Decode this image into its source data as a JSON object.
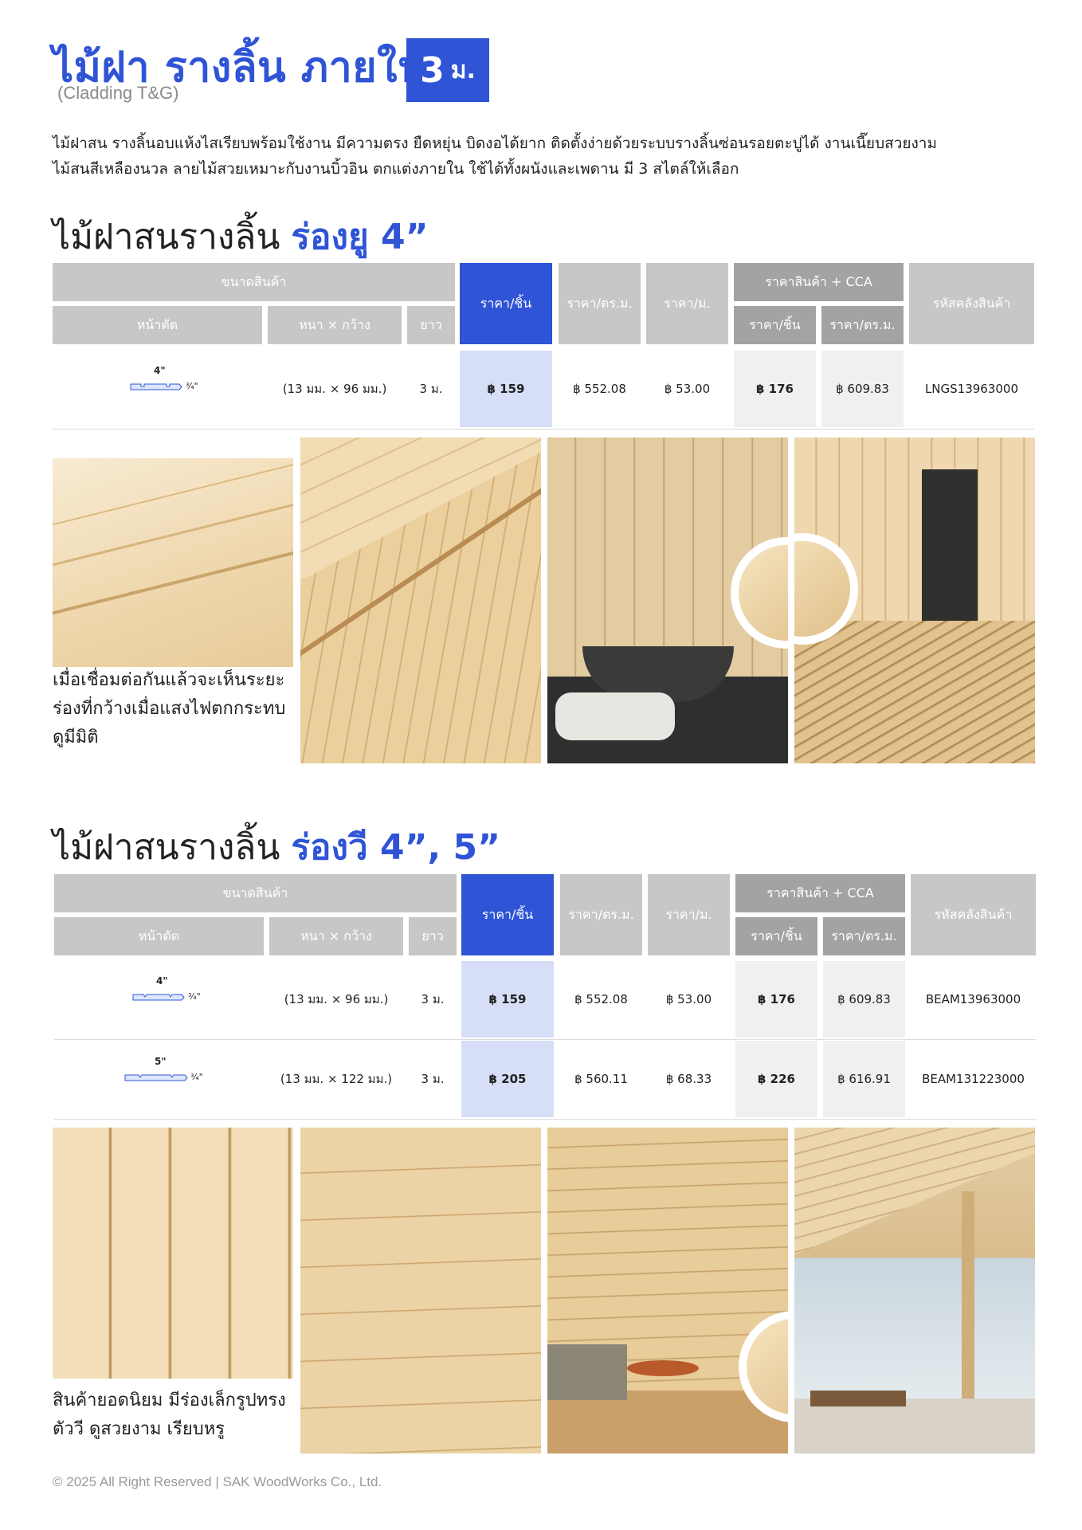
{
  "header": {
    "title": "ไม้ฝา รางลิ้น ภายใน",
    "subtitle": "(Cladding T&G)",
    "badge_number": "3",
    "badge_unit": "ม."
  },
  "intro": {
    "line1": "ไม้ฝาสน รางลิ้นอบแห้งไสเรียบพร้อมใช้งาน มีความตรง ยืดหยุ่น บิดงอได้ยาก ติดตั้งง่ายด้วยระบบรางลิ้นซ่อนรอยตะปูได้ งานเนี๊ยบสวยงาม",
    "line2": "ไม้สนสีเหลืองนวล ลายไม้สวยเหมาะกับงานบิ้วอิน ตกแต่งภายใน ใช้ได้ทั้งผนังและเพดาน มี 3 สไตล์ให้เลือก"
  },
  "table_headers": {
    "size": "ขนาดสินค้า",
    "section": "หน้าตัด",
    "thick_width": "หนา × กว้าง",
    "length": "ยาว",
    "price_piece": "ราคา/ชิ้น",
    "price_sqm": "ราคา/ตร.ม.",
    "price_m": "ราคา/ม.",
    "cca": "ราคาสินค้า + CCA",
    "cca_piece": "ราคา/ชิ้น",
    "cca_sqm": "ราคา/ตร.ม.",
    "sku": "รหัสคลังสินค้า"
  },
  "section1": {
    "title_plain": "ไม้ฝาสนรางลิ้น ",
    "title_highlight": "ร่องยู 4”",
    "rows": [
      {
        "width_label": "4\"",
        "thick_label": "¾\"",
        "size": "(13 มม. × 96 มม.)",
        "length": "3 ม.",
        "price_piece": "฿ 159",
        "price_sqm": "฿ 552.08",
        "price_m": "฿ 53.00",
        "cca_piece": "฿ 176",
        "cca_sqm": "฿ 609.83",
        "sku": "LNGS13963000"
      }
    ],
    "caption_l1": "เมื่อเชื่อมต่อกันแล้วจะเห็นระยะ",
    "caption_l2": "ร่องที่กว้างเมื่อแสงไฟตกกระทบ",
    "caption_l3": "ดูมีมิติ"
  },
  "section2": {
    "title_plain": "ไม้ฝาสนรางลิ้น ",
    "title_highlight": "ร่องวี 4”, 5”",
    "rows": [
      {
        "width_label": "4\"",
        "thick_label": "¾\"",
        "size": "(13 มม. × 96 มม.)",
        "length": "3 ม.",
        "price_piece": "฿ 159",
        "price_sqm": "฿ 552.08",
        "price_m": "฿ 53.00",
        "cca_piece": "฿ 176",
        "cca_sqm": "฿ 609.83",
        "sku": "BEAM13963000"
      },
      {
        "width_label": "5\"",
        "thick_label": "¾\"",
        "size": "(13 มม. × 122 มม.)",
        "length": "3 ม.",
        "price_piece": "฿ 205",
        "price_sqm": "฿ 560.11",
        "price_m": "฿ 68.33",
        "cca_piece": "฿ 226",
        "cca_sqm": "฿ 616.91",
        "sku": "BEAM131223000"
      }
    ],
    "caption_l1": "สินค้ายอดนิยม มีร่องเล็กรูปทรง",
    "caption_l2": "ตัววี ดูสวยงาม เรียบหรู"
  },
  "footer": {
    "text": "© 2025 All Right Reserved | SAK WoodWorks Co., Ltd."
  },
  "colors": {
    "accent": "#2f54d6",
    "header_grey": "#c7c7c7",
    "header_dark": "#a3a3a3",
    "price_highlight": "#d6def8",
    "cca_bg": "#f0f0f0",
    "wood_light": "#f1dcb4",
    "wood_mid": "#e3c48f"
  }
}
